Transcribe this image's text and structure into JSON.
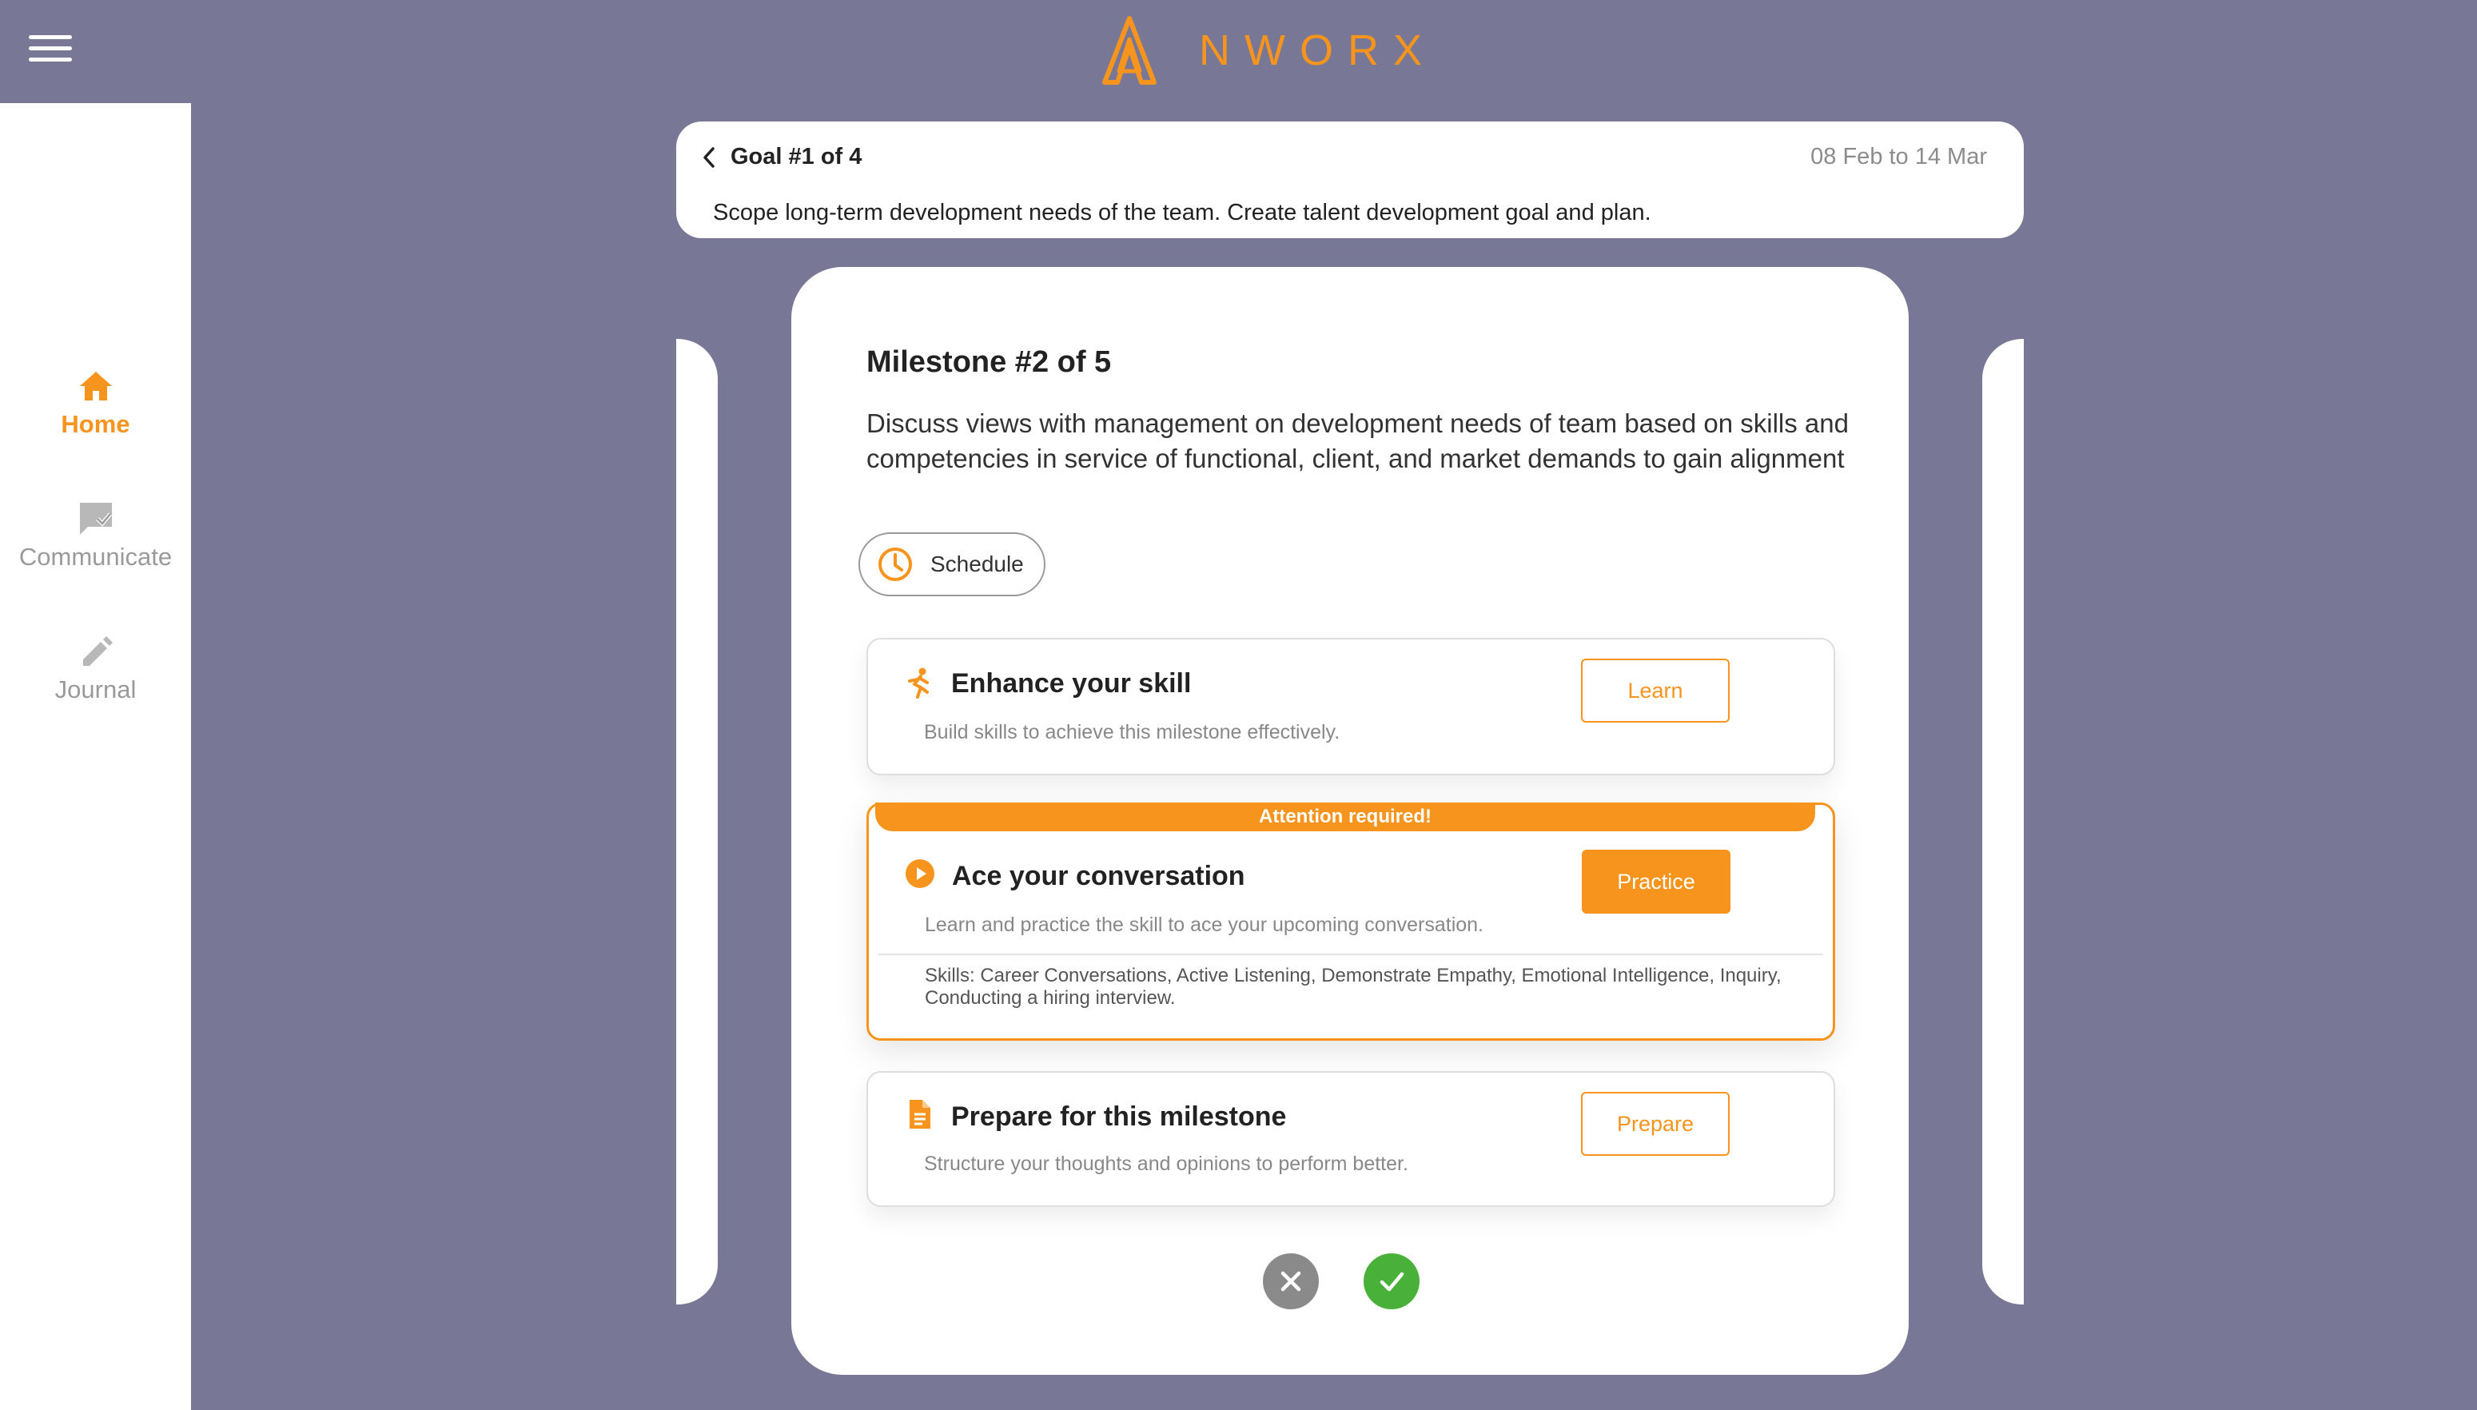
{
  "app": {
    "brand": "NWORX",
    "accent_color": "#f7941d",
    "background_color": "#787896"
  },
  "header": {
    "menu_icon": "hamburger-menu-icon"
  },
  "sidebar": {
    "items": [
      {
        "label": "Home",
        "icon": "home-icon",
        "active": true
      },
      {
        "label": "Communicate",
        "icon": "chat-check-icon",
        "active": false
      },
      {
        "label": "Journal",
        "icon": "pencil-icon",
        "active": false
      }
    ]
  },
  "goal": {
    "title": "Goal #1 of 4",
    "date_range": "08 Feb to 14 Mar",
    "description": "Scope long-term development needs of the team. Create talent development goal and plan."
  },
  "milestone": {
    "title": "Milestone #2 of 5",
    "description": "Discuss views with management on development needs of team based on skills and competencies in service of functional, client, and market demands to gain alignment",
    "schedule_label": "Schedule",
    "tasks": [
      {
        "title": "Enhance your skill",
        "subtitle": "Build skills to achieve this milestone effectively.",
        "button": "Learn",
        "icon": "running-person-icon"
      },
      {
        "banner": "Attention required!",
        "title": "Ace your conversation",
        "subtitle": "Learn and practice the skill to ace your upcoming conversation.",
        "button": "Practice",
        "icon": "play-circle-icon",
        "skills": "Skills: Career Conversations, Active Listening, Demonstrate Empathy, Emotional Intelligence, Inquiry, Conducting a hiring interview."
      },
      {
        "title": "Prepare for this milestone",
        "subtitle": "Structure your thoughts and opinions to perform better.",
        "button": "Prepare",
        "icon": "document-icon"
      }
    ]
  },
  "actions": {
    "reject_icon": "close-icon",
    "accept_icon": "check-icon",
    "reject_color": "#8a8a8a",
    "accept_color": "#49b13a"
  }
}
